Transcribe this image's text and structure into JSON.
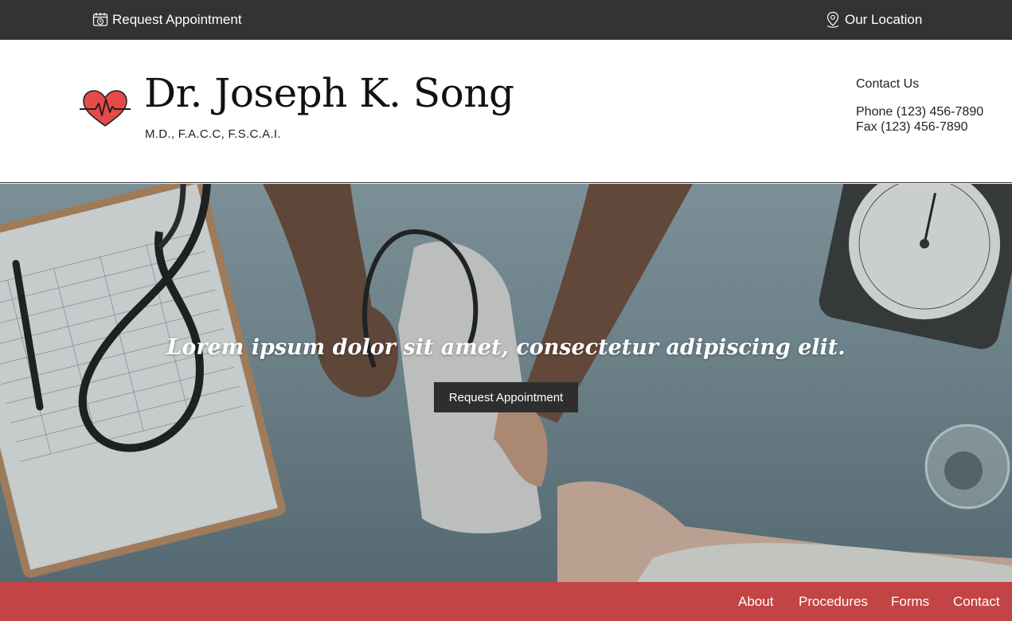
{
  "topbar": {
    "request_label": "Request Appointment",
    "request_icon": "calendar-clock-icon",
    "location_label": "Our Location",
    "location_icon": "map-pin-icon"
  },
  "header": {
    "logo_icon": "heart-pulse-icon",
    "name": "Dr. Joseph K. Song",
    "credentials": "M.D., F.A.C.C, F.S.C.A.I.",
    "contact_heading": "Contact Us",
    "phone": "Phone (123) 456-7890",
    "fax": "Fax (123) 456-7890"
  },
  "hero": {
    "tagline": "Lorem ipsum dolor sit amet, consectetur adipiscing elit.",
    "cta_label": "Request Appointment"
  },
  "nav": {
    "items": [
      "About",
      "Procedures",
      "Forms",
      "Contact"
    ]
  },
  "colors": {
    "topbar_bg": "#333333",
    "accent_red": "#c24444",
    "heart_red": "#e84a4a",
    "button_bg": "#2e2e2e"
  }
}
